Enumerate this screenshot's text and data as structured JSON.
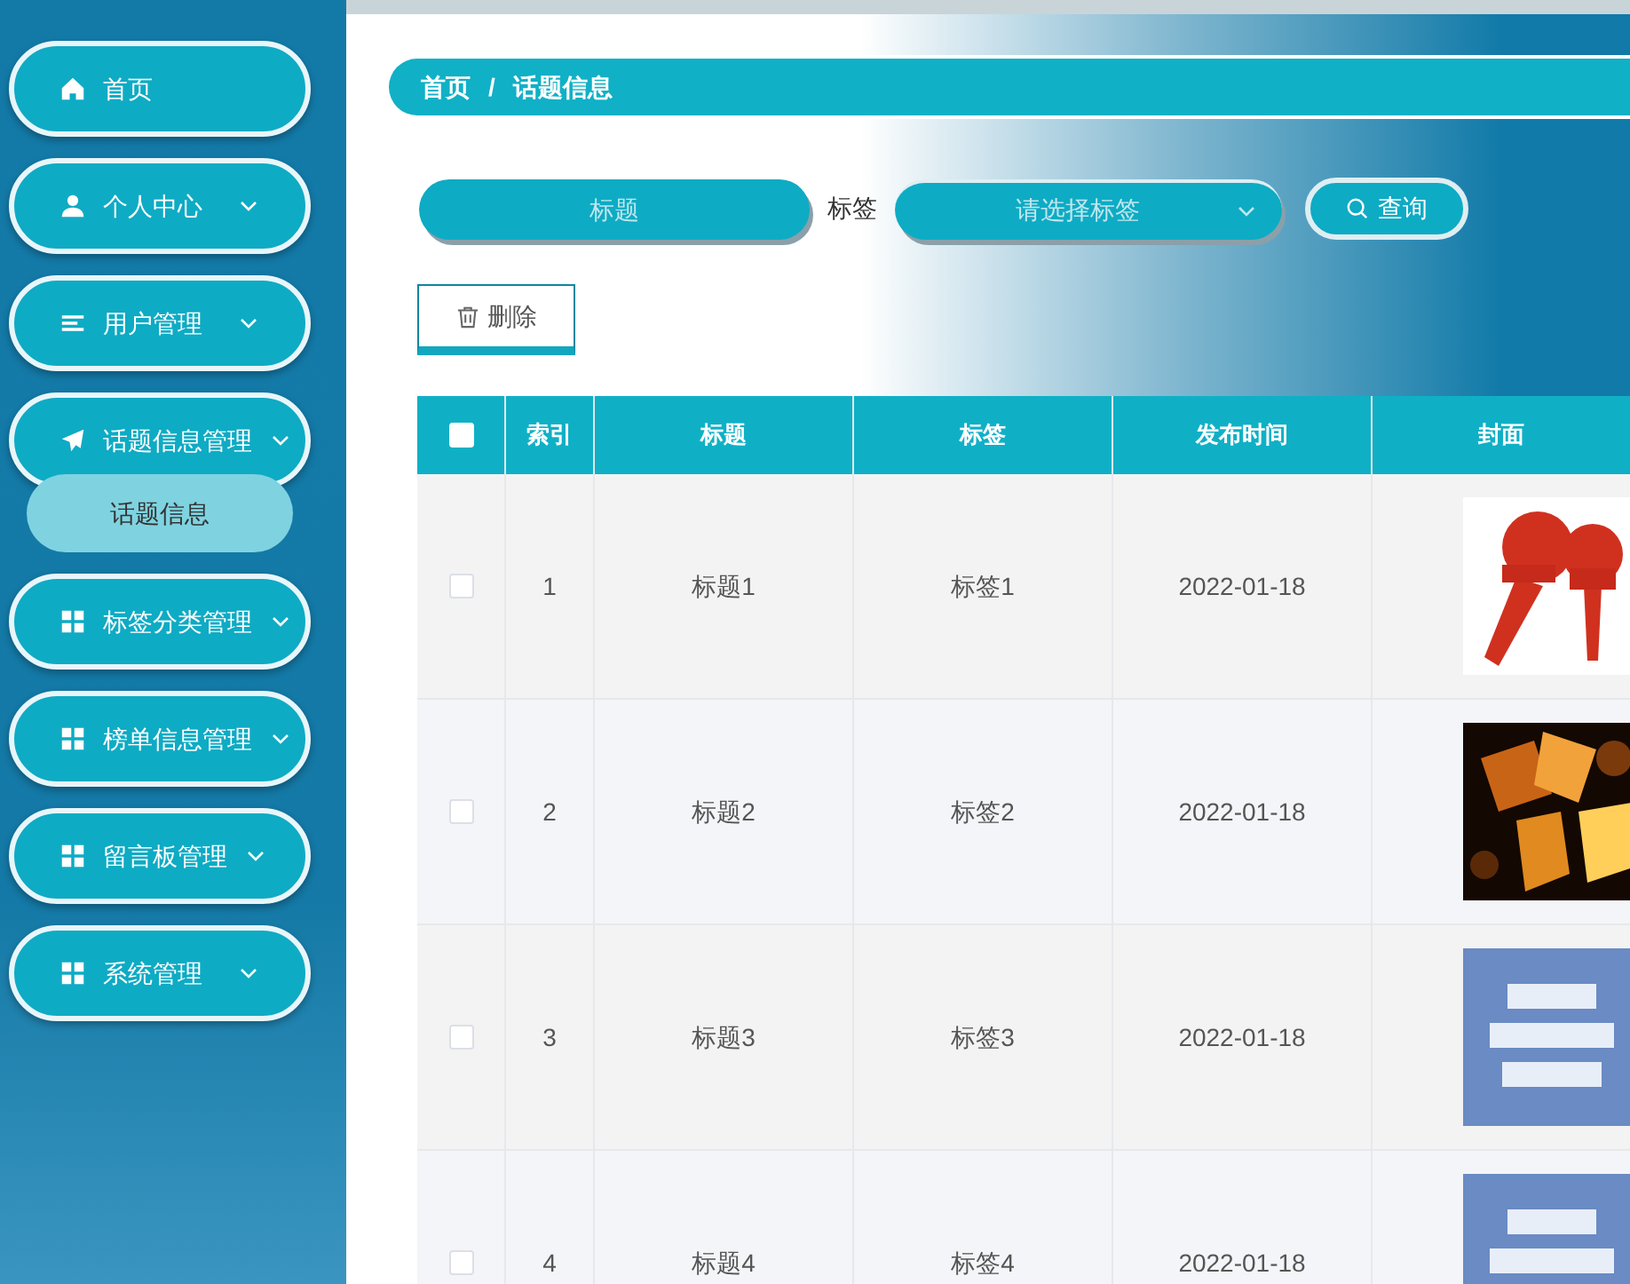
{
  "sidebar": {
    "items": [
      {
        "label": "首页"
      },
      {
        "label": "个人中心",
        "has_submenu": true
      },
      {
        "label": "用户管理",
        "has_submenu": true
      },
      {
        "label": "话题信息管理",
        "has_submenu": true,
        "children": [
          {
            "label": "话题信息",
            "selected": true
          }
        ]
      },
      {
        "label": "标签分类管理",
        "has_submenu": true
      },
      {
        "label": "榜单信息管理",
        "has_submenu": true
      },
      {
        "label": "留言板管理",
        "has_submenu": true
      },
      {
        "label": "系统管理",
        "has_submenu": true
      }
    ]
  },
  "breadcrumb": [
    "首页",
    "话题信息"
  ],
  "breadcrumb_separator": "/",
  "search": {
    "title_field": {
      "placeholder": "标题"
    },
    "tag_label": "标签",
    "tag_select": {
      "placeholder": "请选择标签"
    },
    "query_button": "查询"
  },
  "delete_button": "删除",
  "table": {
    "columns": [
      "索引",
      "标题",
      "标签",
      "发布时间",
      "封面"
    ],
    "all_checked": false,
    "rows": [
      {
        "checked": false,
        "cells": [
          "1",
          "标题1",
          "标签1",
          "2022-01-18"
        ],
        "cover": {
          "kind": "picture"
        }
      },
      {
        "checked": false,
        "cells": [
          "2",
          "标题2",
          "标签2",
          "2022-01-18"
        ],
        "cover": {
          "kind": "picture"
        }
      },
      {
        "checked": false,
        "cells": [
          "3",
          "标题3",
          "标签3",
          "2022-01-18"
        ],
        "cover": {
          "kind": "picture"
        }
      },
      {
        "checked": false,
        "cells": [
          "4",
          "标题4",
          "标签4",
          "2022-01-18"
        ],
        "cover": {
          "kind": "picture"
        }
      }
    ]
  }
}
